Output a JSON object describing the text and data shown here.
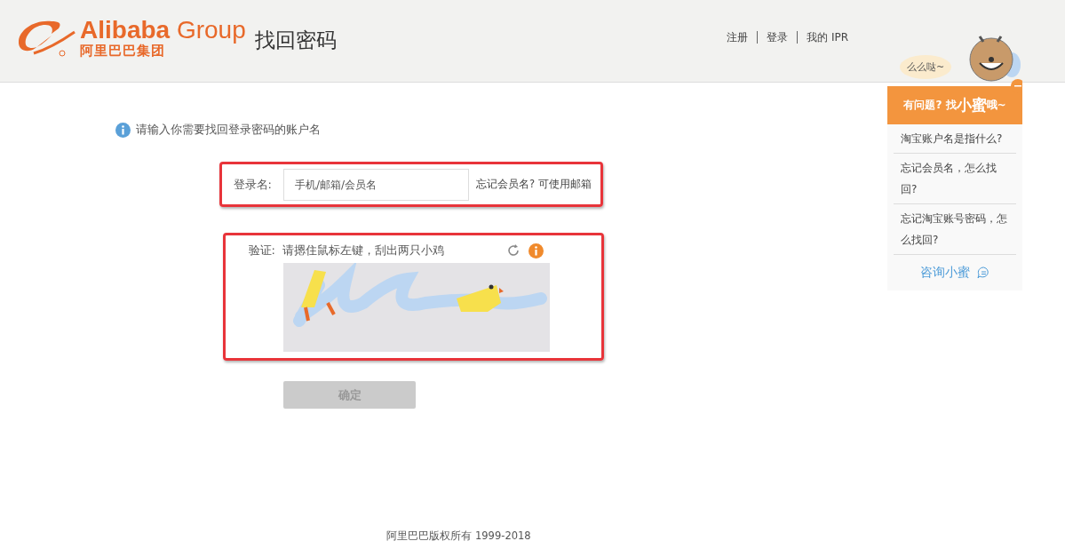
{
  "header": {
    "logo_wordmark": "Alibaba",
    "logo_group": "Group",
    "logo_chinese": "阿里巴巴集团",
    "title": "找回密码",
    "nav": [
      "注册",
      "登录",
      "我的 IPR"
    ]
  },
  "intro": "请输入你需要找回登录密码的账户名",
  "account_row": {
    "highlighted": true,
    "label": "登录名:",
    "placeholder": "手机/邮箱/会员名",
    "hint": "忘记会员名? 可使用邮箱"
  },
  "verify_row": {
    "highlighted": true,
    "label": "验证:",
    "instruction": "请摁住鼠标左键，刮出两只小鸡"
  },
  "submit": {
    "label": "确定",
    "disabled": true
  },
  "footer": "阿里巴巴版权所有 1999-2018",
  "helper": {
    "bubble": "么么哒~",
    "title_before": "有问题? 找",
    "title_name": "小蜜",
    "title_after": "哦~",
    "questions": [
      "淘宝账户名是指什么?",
      "忘记会员名，怎么找回?",
      "忘记淘宝账号密码，怎么找回?"
    ],
    "consult": "咨询小蜜"
  }
}
